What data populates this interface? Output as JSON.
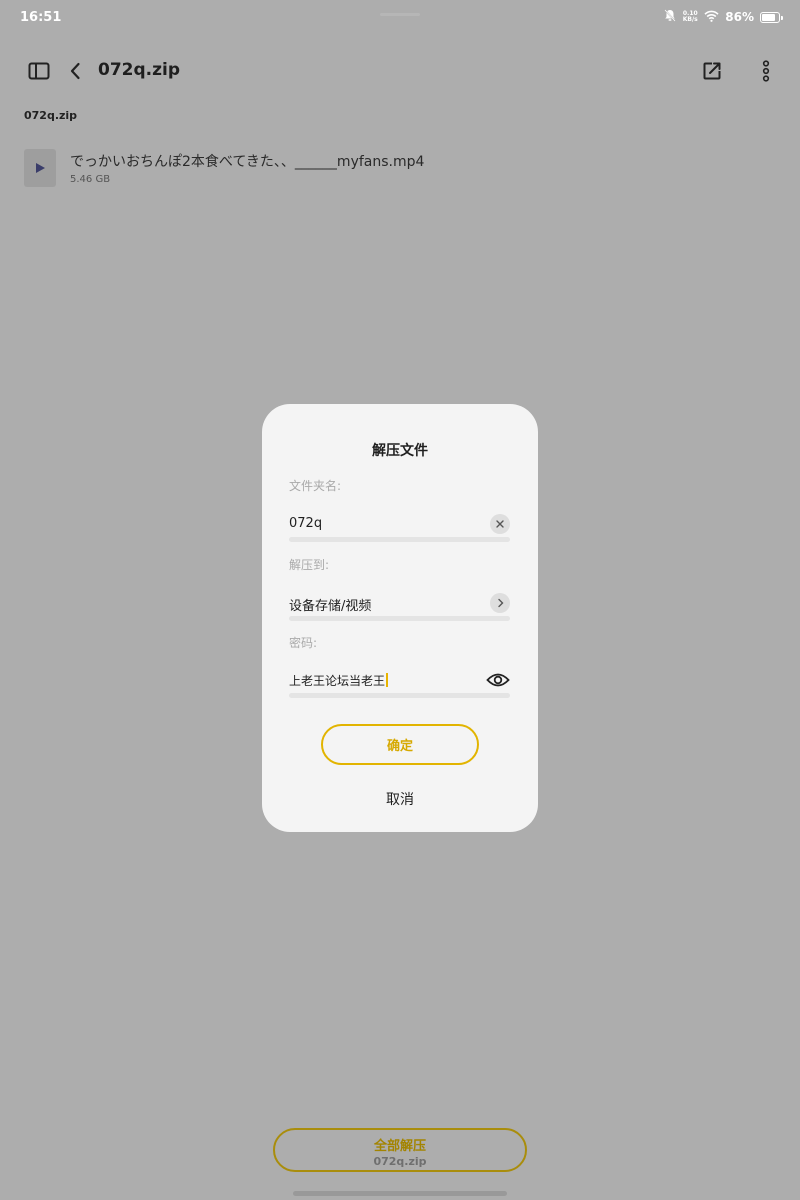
{
  "status_bar": {
    "time": "16:51",
    "net_speed_top": "0.10",
    "net_speed_unit": "KB/s",
    "battery": "86%",
    "battery_level": 0.86
  },
  "appbar": {
    "title": "072q.zip"
  },
  "breadcrumb": "072q.zip",
  "files": [
    {
      "name": "でっかいおちんぽ2本食べてきた、、______myfans.mp4",
      "size": "5.46 GB"
    }
  ],
  "dialog": {
    "title": "解压文件",
    "folder_label": "文件夹名:",
    "folder_value": "072q",
    "dest_label": "解压到:",
    "dest_value": "设备存储/视频",
    "password_label": "密码:",
    "password_value": "上老王论坛当老王",
    "ok_label": "确定",
    "cancel_label": "取消"
  },
  "bottom": {
    "extract_all_label": "全部解压",
    "extract_all_sub": "072q.zip"
  },
  "colors": {
    "accent": "#e2b400",
    "overlay": "#adadad",
    "dialog_bg": "#f4f4f4"
  }
}
